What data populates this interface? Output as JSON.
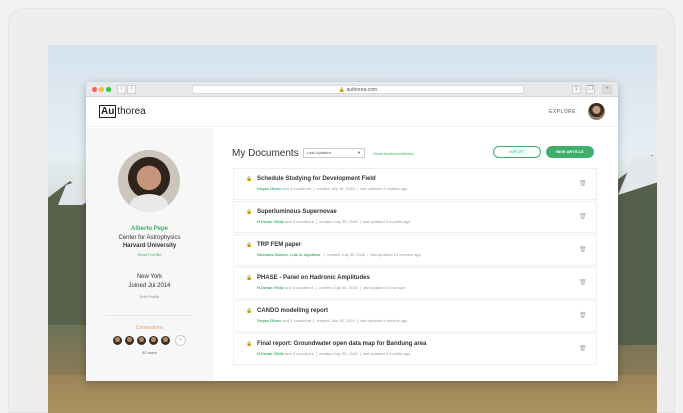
{
  "browser": {
    "url": "authorea.com"
  },
  "header": {
    "logo_box": "Au",
    "logo_rest": "thorea",
    "explore": "EXPLORE"
  },
  "profile": {
    "name": "Alberto Pepe",
    "institution": "Center for Astrophysics",
    "university": "Harvard University",
    "read_bio": "Read Full Bio",
    "city": "New York",
    "joined": "Joined Jul 2014",
    "edit": "Edit Profile",
    "connections_label": "Connections",
    "connections_more": "40 more"
  },
  "main": {
    "title": "My Documents",
    "sort": "Last Updated",
    "archived_link": "Show Archived Articles",
    "import_label": "IMPORT",
    "new_label": "NEW ARTICLE"
  },
  "documents": [
    {
      "title": "Schedule Studying for Development Field",
      "author": "Deyan Ginev",
      "coauthors": "and 3 coauthors",
      "created": "created July 30, 2016",
      "updated": "last updated 4 months ago"
    },
    {
      "title": "Superluminous Supernovae",
      "author": "H.Duran Yildiz",
      "coauthors": "and 3 coauthors",
      "created": "created July 30, 2016",
      "updated": "last updated 2 months ago"
    },
    {
      "title": "TRP FEM paper",
      "author": "Nicholas Davies, Luis A. Apolinar",
      "coauthors": "",
      "created": "created July 30, 2016",
      "updated": "last updated 10 minutes ago"
    },
    {
      "title": "PHASE - Panel on Hadronic Amplitudes",
      "author": "H.Duran Yildiz",
      "coauthors": "and 6 coauthors",
      "created": "created July 30, 2016",
      "updated": "last updated 1 hour ago"
    },
    {
      "title": "CANDO modelling report",
      "author": "Deyan Ginev",
      "coauthors": "and 3 coauthors",
      "created": "created July 30, 2016",
      "updated": "last updated 4 months ago"
    },
    {
      "title": "Final report: Groundwater open data map for Bandung area",
      "author": "H.Duran Yildiz",
      "coauthors": "and 3 coauthors",
      "created": "created July 30, 2016",
      "updated": "last updated 4 months ago"
    }
  ]
}
